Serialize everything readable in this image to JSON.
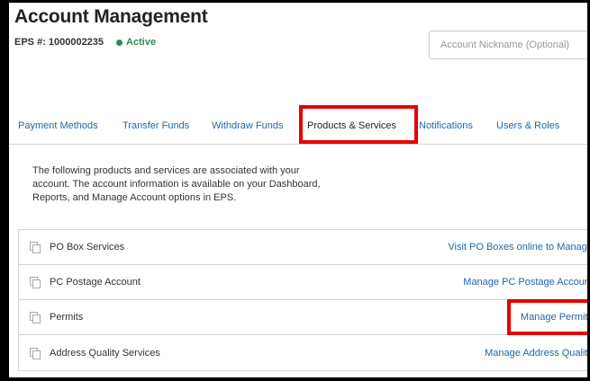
{
  "header": {
    "title": "Account Management",
    "eps_label": "EPS #:",
    "eps_number": "1000002235",
    "status": "Active",
    "status_color": "#2e8b57",
    "nickname_placeholder": "Account Nickname (Optional)"
  },
  "tabs": [
    {
      "label": "Payment Methods",
      "active": false
    },
    {
      "label": "Transfer Funds",
      "active": false
    },
    {
      "label": "Withdraw Funds",
      "active": false
    },
    {
      "label": "Products & Services",
      "active": true
    },
    {
      "label": "Notifications",
      "active": false
    },
    {
      "label": "Users & Roles",
      "active": false
    }
  ],
  "description": "The following products and services are associated with your account. The account information is available on your Dashboard, Reports, and Manage Account options in EPS.",
  "services": [
    {
      "name": "PO Box Services",
      "link": "Visit PO Boxes online to Manage",
      "icon": "copy-icon"
    },
    {
      "name": "PC Postage Account",
      "link": "Manage PC Postage Account",
      "icon": "copy-icon"
    },
    {
      "name": "Permits",
      "link": "Manage Permits",
      "icon": "copy-icon"
    },
    {
      "name": "Address Quality Services",
      "link": "Manage Address Quality",
      "icon": "copy-icon"
    }
  ],
  "colors": {
    "link": "#2266aa",
    "highlight": "#e60000"
  }
}
